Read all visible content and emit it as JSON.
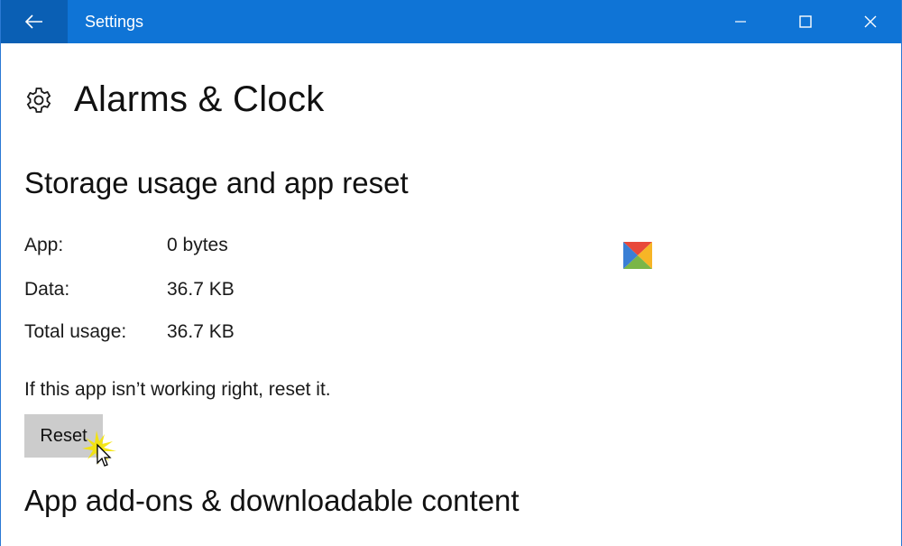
{
  "window": {
    "title": "Settings",
    "accent": "#0f74d6"
  },
  "titlebar": {
    "back_icon": "arrow-left-icon",
    "minimize_icon": "minimize-icon",
    "maximize_icon": "maximize-icon",
    "close_icon": "close-icon"
  },
  "header": {
    "icon": "gear-icon",
    "title": "Alarms & Clock"
  },
  "storage": {
    "title": "Storage usage and app reset",
    "rows": [
      {
        "label": "App:",
        "value": "0 bytes"
      },
      {
        "label": "Data:",
        "value": "36.7 KB"
      },
      {
        "label": "Total usage:",
        "value": "36.7 KB"
      }
    ],
    "reset_hint": "If this app isn’t working right, reset it.",
    "reset_label": "Reset"
  },
  "addons": {
    "title": "App add-ons & downloadable content"
  }
}
